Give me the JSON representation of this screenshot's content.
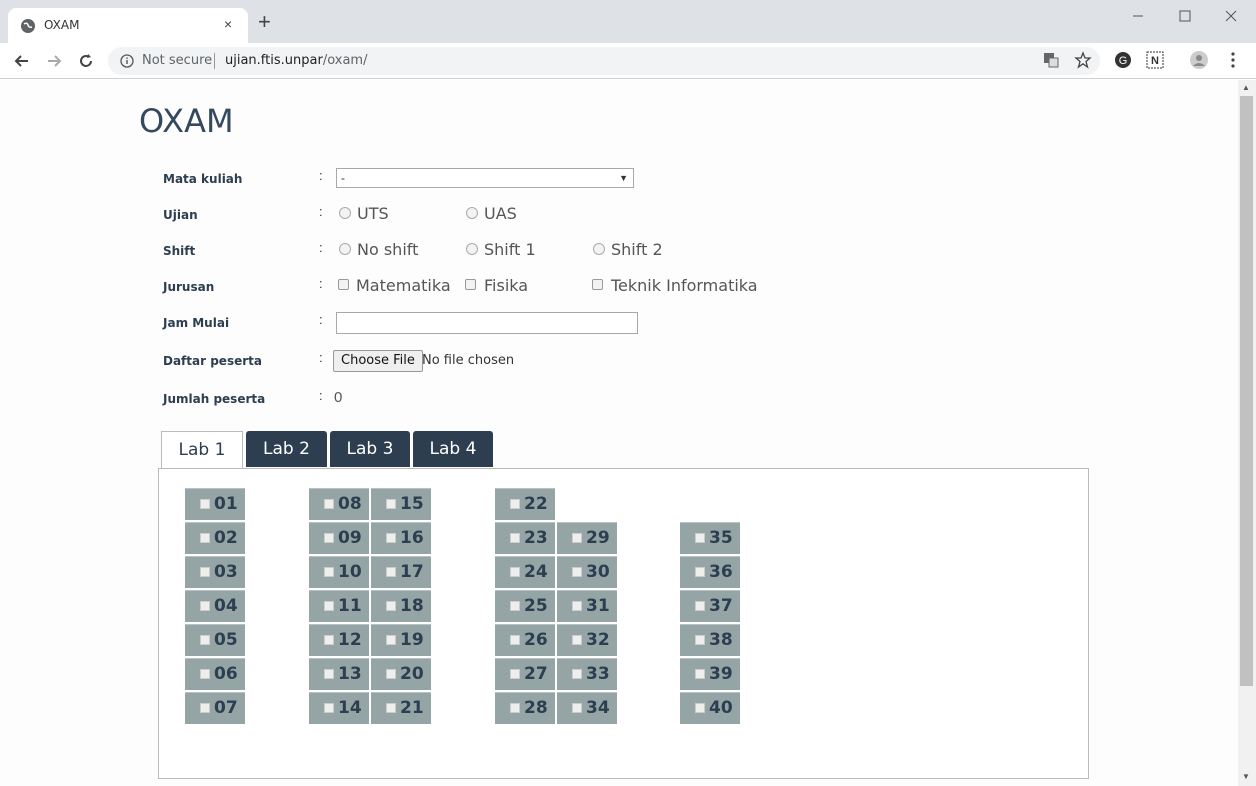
{
  "browser": {
    "tab_title": "OXAM",
    "tab_close": "×",
    "new_tab": "+",
    "not_secure": "Not secure",
    "url_host": "ujian.ftis.unpar",
    "url_path": "/oxam/"
  },
  "app": {
    "title": "OXAM"
  },
  "form": {
    "colon": ":",
    "mata_kuliah": {
      "label": "Mata kuliah",
      "selected": "-"
    },
    "ujian": {
      "label": "Ujian",
      "options": [
        "UTS",
        "UAS"
      ]
    },
    "shift": {
      "label": "Shift",
      "options": [
        "No shift",
        "Shift 1",
        "Shift 2"
      ]
    },
    "jurusan": {
      "label": "Jurusan",
      "options": [
        "Matematika",
        "Fisika",
        "Teknik Informatika"
      ]
    },
    "jam_mulai": {
      "label": "Jam Mulai",
      "value": ""
    },
    "daftar_peserta": {
      "label": "Daftar peserta",
      "button": "Choose File",
      "status": "No file chosen"
    },
    "jumlah_peserta": {
      "label": "Jumlah peserta",
      "value": "0"
    }
  },
  "labs": {
    "tabs": [
      "Lab 1",
      "Lab 2",
      "Lab 3",
      "Lab 4"
    ],
    "active": "Lab 1"
  },
  "seats": [
    "01",
    "02",
    "03",
    "04",
    "05",
    "06",
    "07",
    "08",
    "09",
    "10",
    "11",
    "12",
    "13",
    "14",
    "15",
    "16",
    "17",
    "18",
    "19",
    "20",
    "21",
    "22",
    "23",
    "24",
    "25",
    "26",
    "27",
    "28",
    "29",
    "30",
    "31",
    "32",
    "33",
    "34",
    "35",
    "36",
    "37",
    "38",
    "39",
    "40"
  ]
}
